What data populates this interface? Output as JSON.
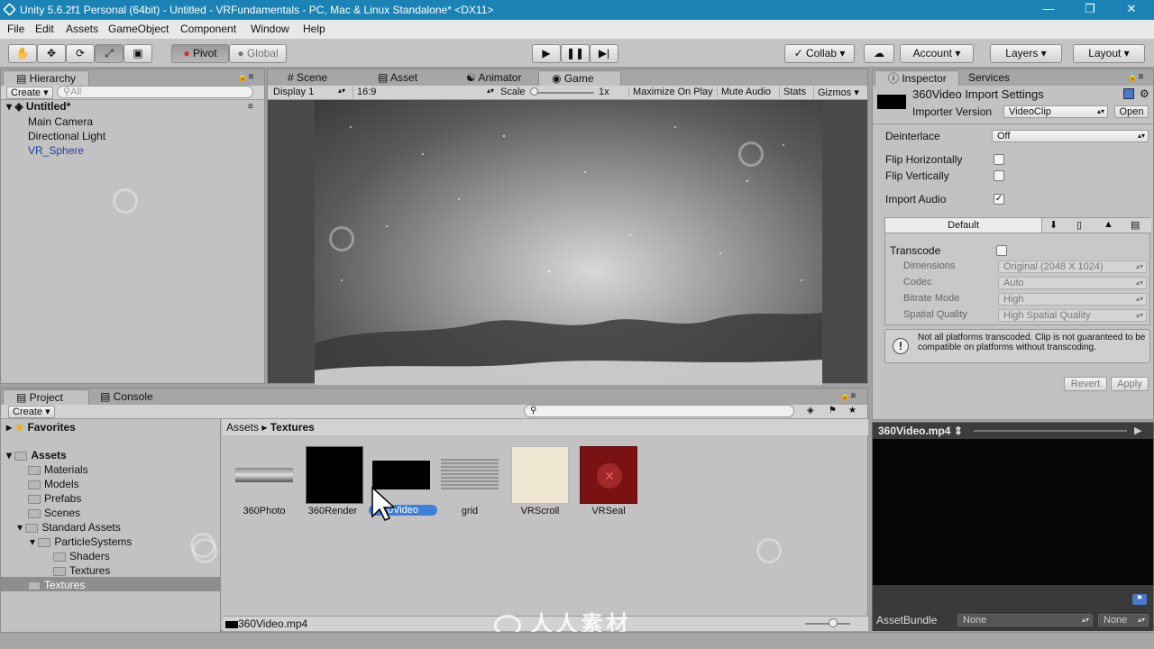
{
  "window": {
    "title": "Unity 5.6.2f1 Personal (64bit) - Untitled - VRFundamentals - PC, Mac & Linux Standalone* <DX11>"
  },
  "menu": [
    "File",
    "Edit",
    "Assets",
    "GameObject",
    "Component",
    "Window",
    "Help"
  ],
  "toolbar": {
    "pivot": "Pivot",
    "global": "Global",
    "collab": "Collab",
    "account": "Account",
    "layers": "Layers",
    "layout": "Layout"
  },
  "hierarchy": {
    "tab": "Hierarchy",
    "create": "Create",
    "search_placeholder": "All",
    "scene": "Untitled*",
    "items": [
      "Main Camera",
      "Directional Light",
      "VR_Sphere"
    ]
  },
  "center_tabs": [
    "Scene",
    "Asset Store",
    "Animator",
    "Game"
  ],
  "game_bar": {
    "display": "Display 1",
    "aspect": "16:9",
    "scale_label": "Scale",
    "scale_value": "1x",
    "maximize": "Maximize On Play",
    "mute": "Mute Audio",
    "stats": "Stats",
    "gizmos": "Gizmos"
  },
  "project": {
    "tab": "Project",
    "console_tab": "Console",
    "create": "Create",
    "favorites": "Favorites",
    "assets_root": "Assets",
    "tree": [
      "Materials",
      "Models",
      "Prefabs",
      "Scenes",
      "Standard Assets",
      "ParticleSystems",
      "Shaders",
      "Textures",
      "Textures"
    ],
    "breadcrumb": [
      "Assets",
      "Textures"
    ],
    "assets": [
      "360Photo",
      "360Render",
      "360Video",
      "grid",
      "VRScroll",
      "VRSeal"
    ],
    "selected_label": "0Video",
    "status_file": "360Video.mp4"
  },
  "inspector": {
    "tab": "Inspector",
    "services_tab": "Services",
    "title": "360Video Import Settings",
    "importer_label": "Importer Version",
    "importer_value": "VideoClip",
    "open": "Open",
    "deinterlace_label": "Deinterlace",
    "deinterlace_value": "Off",
    "flip_h": "Flip Horizontally",
    "flip_v": "Flip Vertically",
    "import_audio": "Import Audio",
    "import_audio_checked": true,
    "platform_default": "Default",
    "transcode": "Transcode",
    "dimensions_label": "Dimensions",
    "dimensions_value": "Original (2048 X 1024)",
    "codec_label": "Codec",
    "codec_value": "Auto",
    "bitrate_label": "Bitrate Mode",
    "bitrate_value": "High",
    "spatial_label": "Spatial Quality",
    "spatial_value": "High Spatial Quality",
    "warning": "Not all platforms transcoded. Clip is not guaranteed to be compatible on platforms without transcoding.",
    "revert": "Revert",
    "apply": "Apply"
  },
  "preview": {
    "title": "360Video.mp4",
    "assetbundle_label": "AssetBundle",
    "bundle_value": "None",
    "variant_value": "None"
  },
  "watermark": "人人素材"
}
